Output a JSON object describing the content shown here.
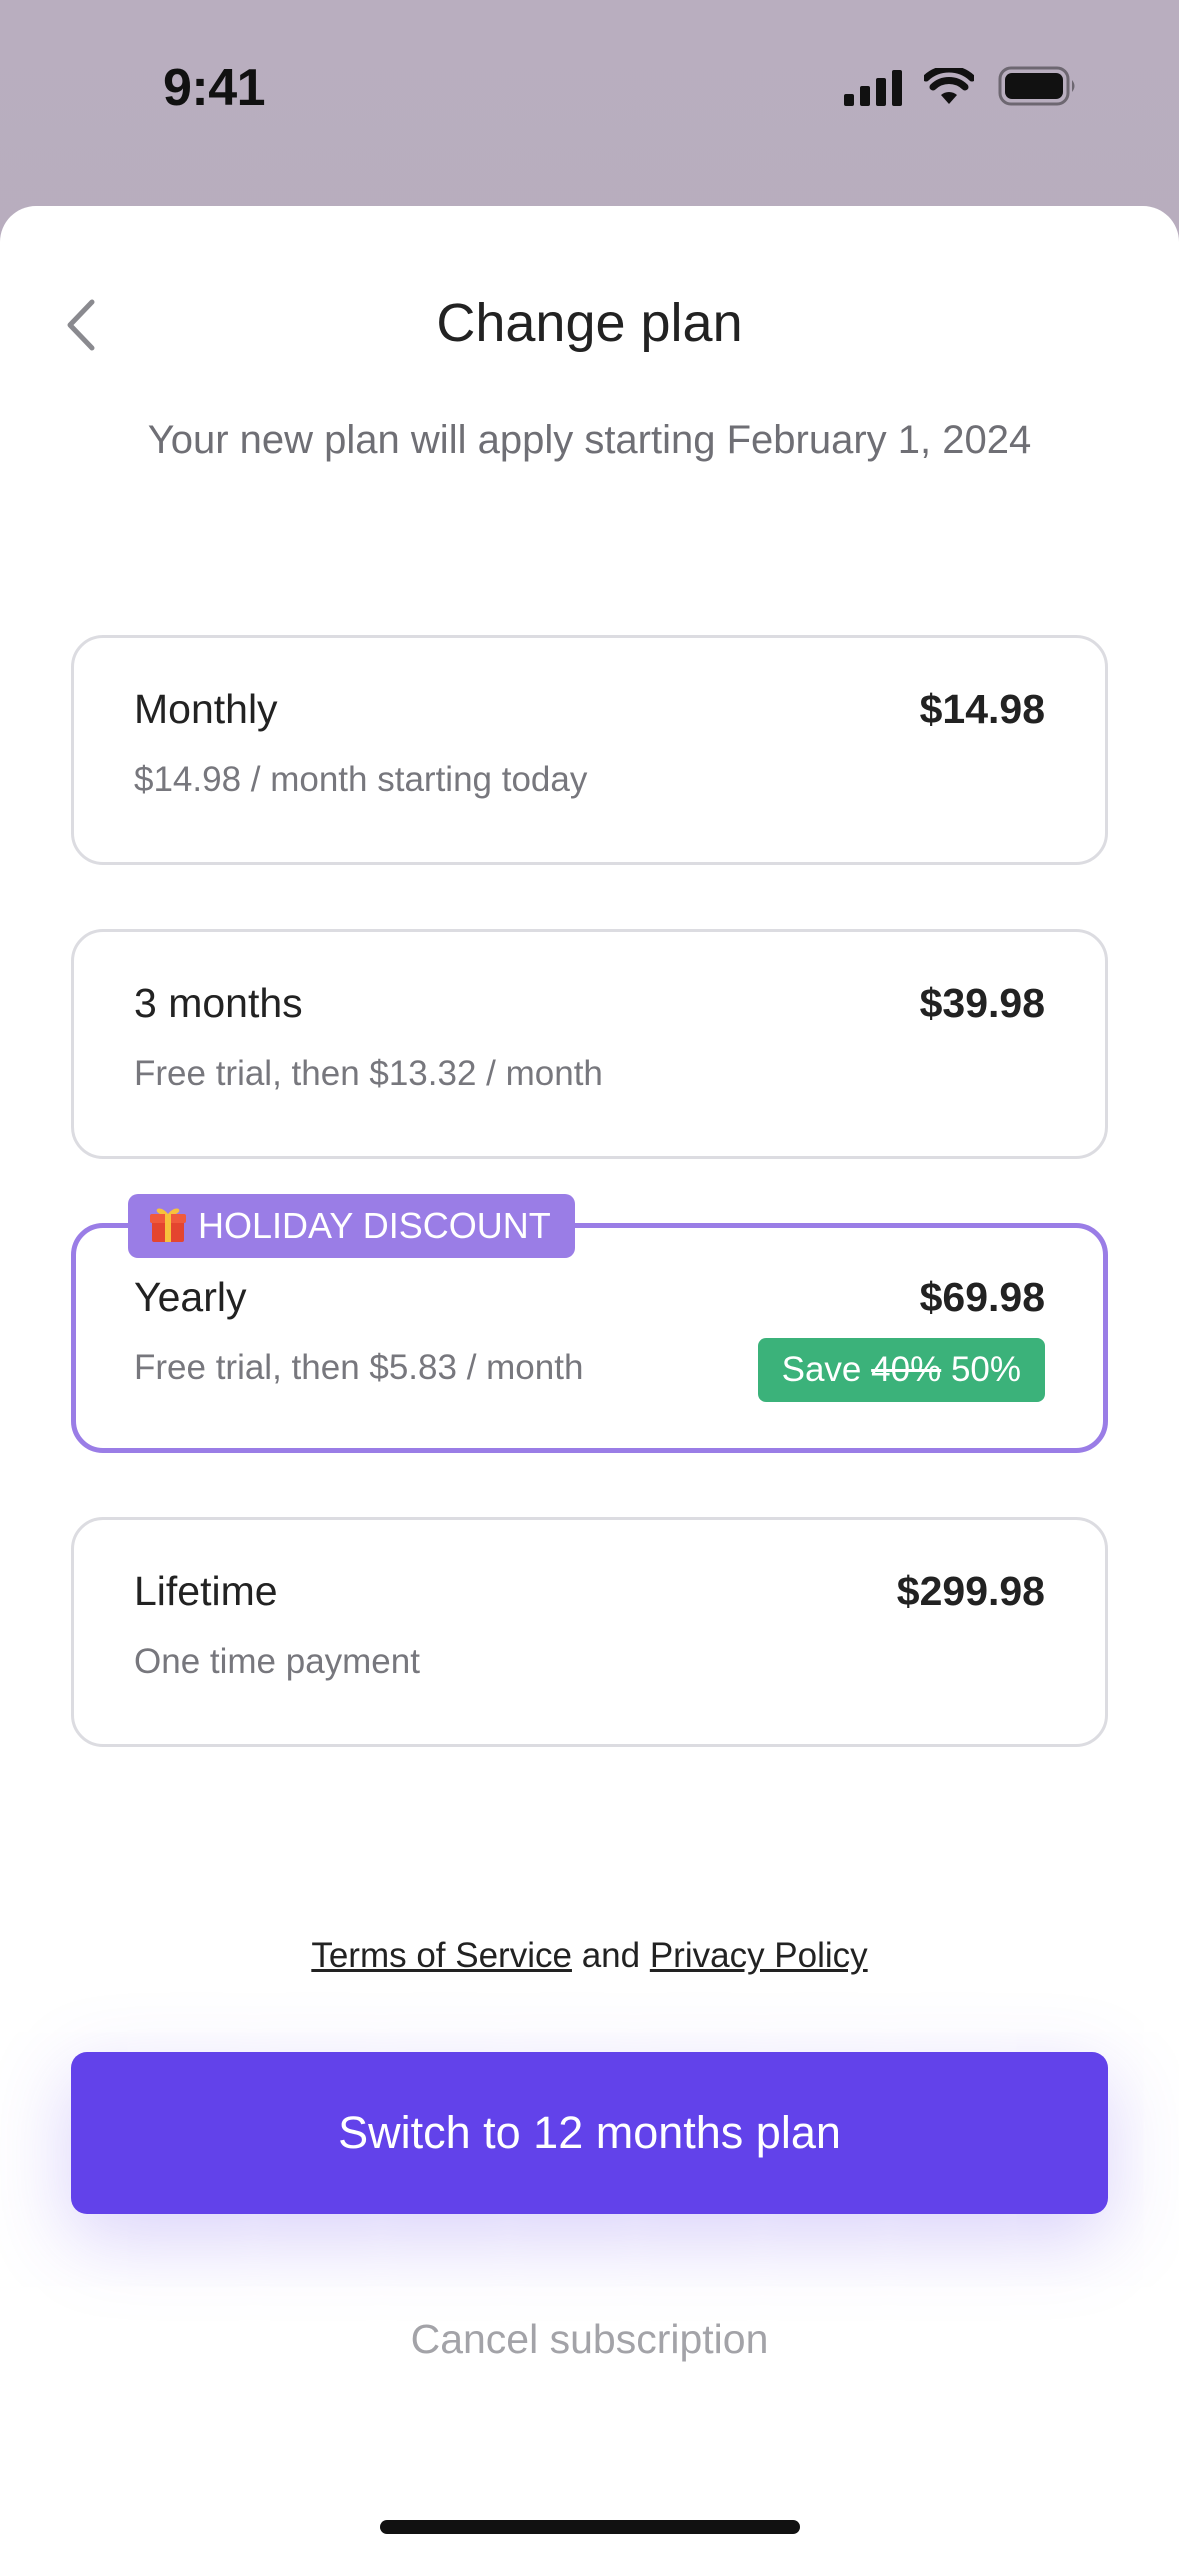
{
  "status_bar": {
    "time": "9:41",
    "icons": [
      "cellular-signal-icon",
      "wifi-icon",
      "battery-icon"
    ]
  },
  "header": {
    "back_icon": "chevron-left-icon",
    "title": "Change plan",
    "subtitle": "Your new plan will apply starting February 1, 2024"
  },
  "plans": [
    {
      "name": "Monthly",
      "price": "$14.98",
      "description": "$14.98 / month starting today",
      "selected": false
    },
    {
      "name": "3 months",
      "price": "$39.98",
      "description": "Free trial, then $13.32 / month",
      "selected": false
    },
    {
      "name": "Yearly",
      "price": "$69.98",
      "description": "Free trial, then $5.83 / month",
      "selected": true,
      "badge": {
        "icon": "gift-icon",
        "label": "HOLIDAY DISCOUNT"
      },
      "save": {
        "prefix": "Save",
        "old_value": "40%",
        "new_value": "50%"
      }
    },
    {
      "name": "Lifetime",
      "price": "$299.98",
      "description": "One time payment",
      "selected": false
    }
  ],
  "legal": {
    "terms": "Terms of Service",
    "conjunction": "and",
    "privacy": "Privacy Policy"
  },
  "cta": {
    "label": "Switch to 12 months plan"
  },
  "cancel": {
    "label": "Cancel subscription"
  },
  "colors": {
    "accent": "#6242ea",
    "selected_border": "#9a7de6",
    "save_badge": "#3bb27a",
    "backdrop": "#b9aebf"
  }
}
